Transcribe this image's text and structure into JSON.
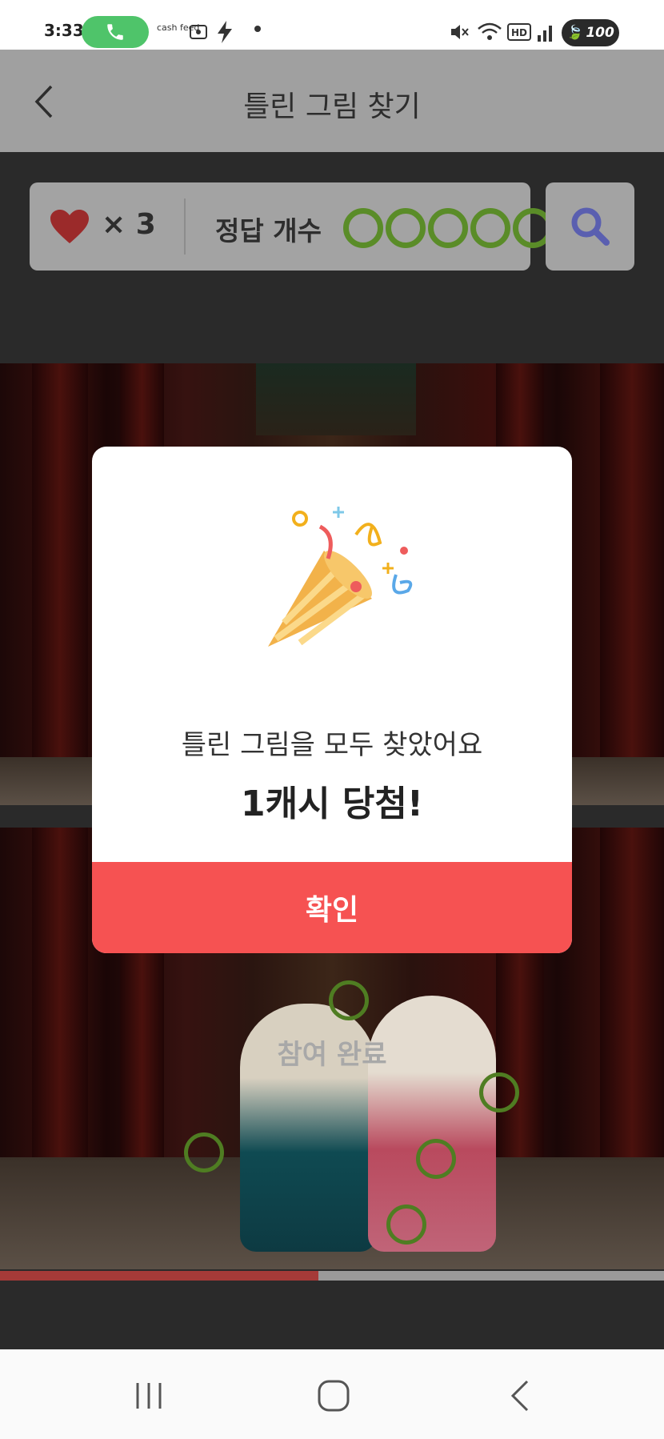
{
  "status_bar": {
    "time": "3:33",
    "app_icon_label": "cash feed",
    "battery": "100"
  },
  "header": {
    "title": "틀린 그림 찾기"
  },
  "info_bar": {
    "lives_text": "× 3",
    "answer_label": "정답 개수",
    "answers_found": 5,
    "answers_total": 5
  },
  "modal": {
    "message": "틀린 그림을 모두 찾았어요",
    "prize": "1캐시 당첨!",
    "confirm_label": "확인"
  },
  "game": {
    "done_label": "참여 완료",
    "progress": 0.48
  },
  "colors": {
    "accent": "#f65252",
    "found_circle": "#5a8c28",
    "hint_icon": "#5a5fb0"
  }
}
